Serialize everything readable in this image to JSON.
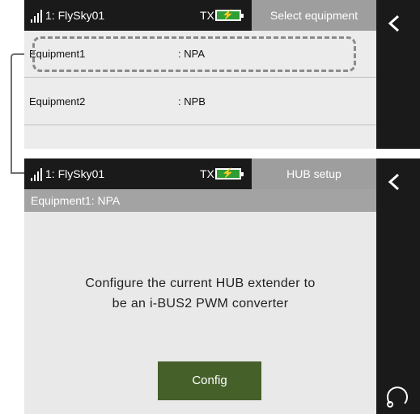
{
  "screens": [
    {
      "model": "1: FlySky01",
      "tx_label": "TX",
      "page_title": "Select equipment",
      "equipment": [
        {
          "name": "Equipment1",
          "value": ": NPA"
        },
        {
          "name": "Equipment2",
          "value": ": NPB"
        }
      ]
    },
    {
      "model": "1: FlySky01",
      "tx_label": "TX",
      "page_title": "HUB setup",
      "subheader": "Equipment1: NPA",
      "message_line1": "Configure the current HUB extender to",
      "message_line2": "be an i-BUS2 PWM converter",
      "config_label": "Config"
    }
  ],
  "icons": [
    "signal-icon",
    "battery-icon",
    "back-icon",
    "rotate-icon"
  ],
  "colors": {
    "status_bar": "#1a1a1a",
    "battery_fill": "#2e9e35",
    "title_bg": "#9e9e9e",
    "config_button": "#456029"
  }
}
